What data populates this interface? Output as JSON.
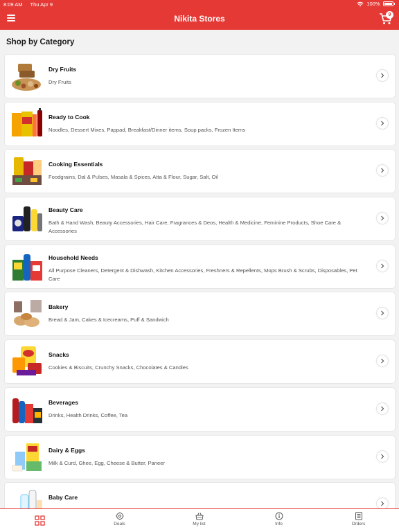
{
  "status_bar": {
    "time": "8:09 AM",
    "date": "Thu Apr 9",
    "battery": "100%"
  },
  "header": {
    "title": "Nikita Stores",
    "cart_count": "9"
  },
  "section_title": "Shop by Category",
  "colors": {
    "brand": "#e53935",
    "text": "#111111",
    "muted": "#555555"
  },
  "categories": [
    {
      "title": "Dry Fruits",
      "desc": "Dry Fruits",
      "icon": "dry-fruits-icon"
    },
    {
      "title": "Ready to Cook",
      "desc": "Noodles, Dessert Mixes, Pappad, Breakfast/Dinner items, Soup packs, Frozen Items",
      "icon": "ready-to-cook-icon"
    },
    {
      "title": "Cooking Essentials",
      "desc": "Foodgrains, Dal & Pulses, Masala & Spices, Atta & Flour, Sugar, Salt, Oil",
      "icon": "cooking-essentials-icon"
    },
    {
      "title": "Beauty Care",
      "desc": "Bath & Hand Wash, Beauty Accessories, Hair Care, Fragrances & Deos, Health & Medicine, Feminine Products, Shoe Care & Accessories",
      "icon": "beauty-care-icon"
    },
    {
      "title": "Household Needs",
      "desc": "All Purpose Cleaners, Detergent & Dishwash, Kitchen Accessories, Freshners & Repellents, Mops Brush & Scrubs, Disposables, Pet Care",
      "icon": "household-needs-icon"
    },
    {
      "title": "Bakery",
      "desc": "Bread & Jam, Cakes & Icecreams, Puff & Sandwich",
      "icon": "bakery-icon"
    },
    {
      "title": "Snacks",
      "desc": "Cookies & Biscuits, Crunchy Snacks, Chocolates & Candies",
      "icon": "snacks-icon"
    },
    {
      "title": "Beverages",
      "desc": "Drinks, Health Drinks, Coffee, Tea",
      "icon": "beverages-icon"
    },
    {
      "title": "Dairy & Eggs",
      "desc": "Milk & Curd, Ghee, Egg, Cheese & Butter, Paneer",
      "icon": "dairy-eggs-icon"
    },
    {
      "title": "Baby Care",
      "desc": "",
      "icon": "baby-care-icon"
    }
  ],
  "tabs": [
    {
      "label": "",
      "icon": "grid-icon",
      "active": true
    },
    {
      "label": "Deals",
      "icon": "deals-icon"
    },
    {
      "label": "My list",
      "icon": "basket-icon"
    },
    {
      "label": "Info",
      "icon": "info-icon"
    },
    {
      "label": "Orders",
      "icon": "orders-icon"
    }
  ]
}
